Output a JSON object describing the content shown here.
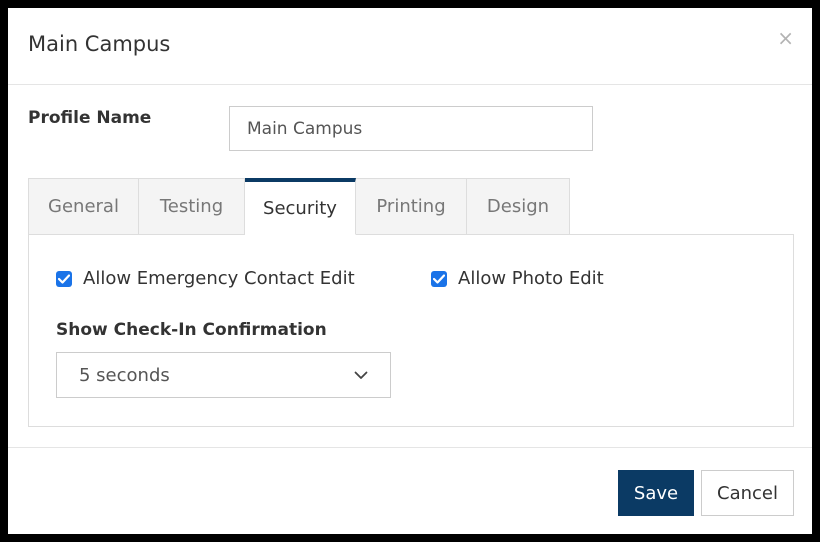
{
  "modal": {
    "title": "Main Campus",
    "close_glyph": "×"
  },
  "form": {
    "profile_name_label": "Profile Name",
    "profile_name_value": "Main Campus"
  },
  "tabs": [
    {
      "label": "General",
      "active": false
    },
    {
      "label": "Testing",
      "active": false
    },
    {
      "label": "Security",
      "active": true
    },
    {
      "label": "Printing",
      "active": false
    },
    {
      "label": "Design",
      "active": false
    }
  ],
  "security": {
    "allow_emergency_contact_edit": {
      "label": "Allow Emergency Contact Edit",
      "checked": true
    },
    "allow_photo_edit": {
      "label": "Allow Photo Edit",
      "checked": true
    },
    "checkin_confirmation": {
      "label": "Show Check-In Confirmation",
      "value": "5 seconds"
    }
  },
  "footer": {
    "save_label": "Save",
    "cancel_label": "Cancel"
  },
  "colors": {
    "primary": "#0b3a64",
    "checkbox": "#1a73e8"
  }
}
